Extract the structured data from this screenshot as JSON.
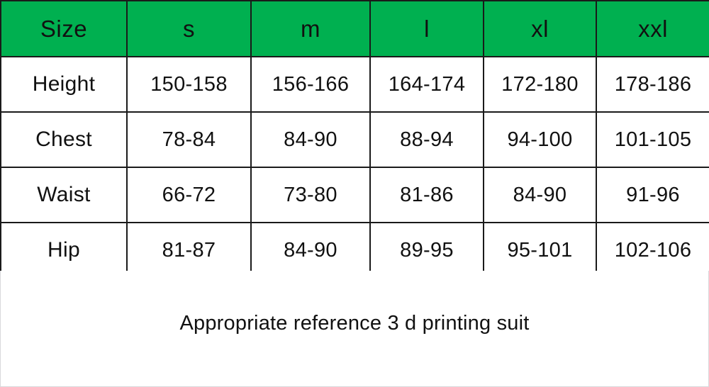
{
  "table": {
    "header": [
      "Size",
      "s",
      "m",
      "l",
      "xl",
      "xxl"
    ],
    "header_bg": "#00b050",
    "rows": [
      {
        "label": "Height",
        "values": [
          "150-158",
          "156-166",
          "164-174",
          "172-180",
          "178-186"
        ]
      },
      {
        "label": "Chest",
        "values": [
          "78-84",
          "84-90",
          "88-94",
          "94-100",
          "101-105"
        ]
      },
      {
        "label": "Waist",
        "values": [
          "66-72",
          "73-80",
          "81-86",
          "84-90",
          "91-96"
        ]
      },
      {
        "label": "Hip",
        "values": [
          "81-87",
          "84-90",
          "89-95",
          "95-101",
          "102-106"
        ]
      }
    ]
  },
  "caption": {
    "text": "Appropriate reference 3 d printing suit"
  },
  "chart_data": {
    "type": "table",
    "title": "Size chart",
    "categories": [
      "Size",
      "s",
      "m",
      "l",
      "xl",
      "xxl"
    ],
    "series": [
      {
        "name": "Height",
        "values": [
          "150-158",
          "156-166",
          "164-174",
          "172-180",
          "178-186"
        ]
      },
      {
        "name": "Chest",
        "values": [
          "78-84",
          "84-90",
          "88-94",
          "94-100",
          "101-105"
        ]
      },
      {
        "name": "Waist",
        "values": [
          "66-72",
          "73-80",
          "81-86",
          "84-90",
          "91-96"
        ]
      },
      {
        "name": "Hip",
        "values": [
          "81-87",
          "84-90",
          "89-95",
          "95-101",
          "102-106"
        ]
      }
    ],
    "annotations": [
      "Appropriate reference 3 d printing suit"
    ]
  }
}
